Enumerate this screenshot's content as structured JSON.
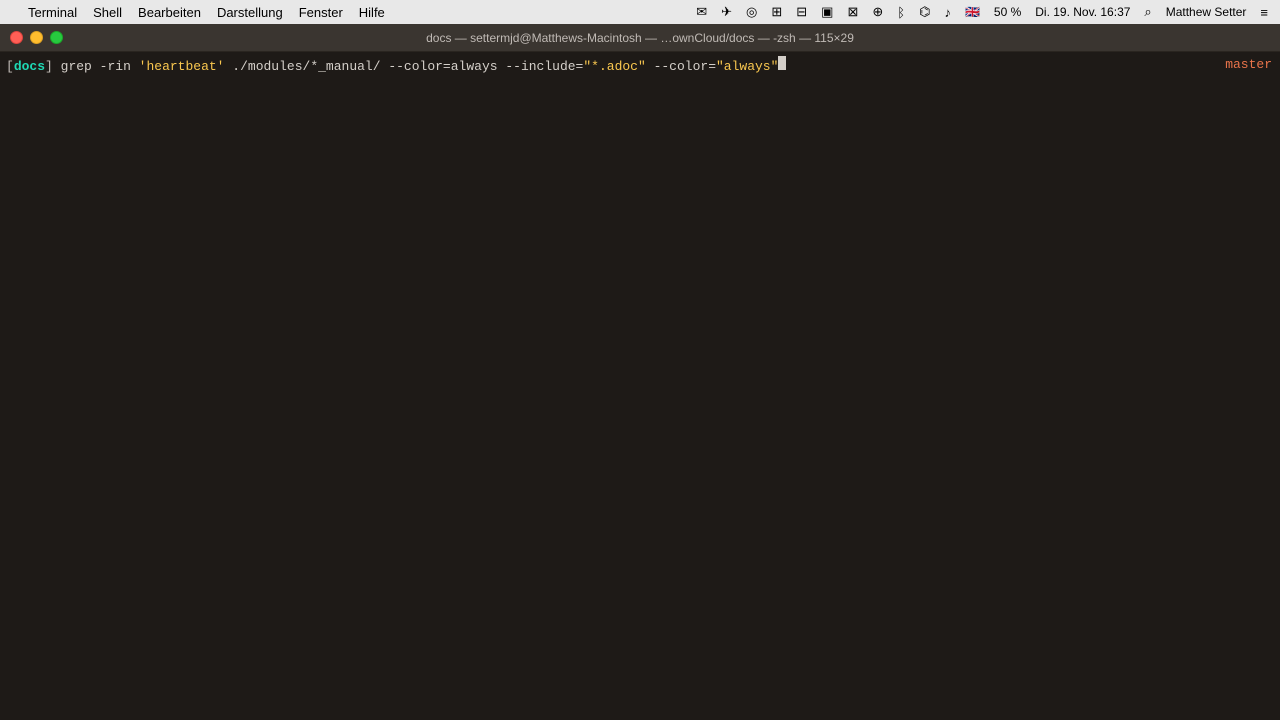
{
  "menubar": {
    "apple_label": "",
    "items": [
      {
        "id": "terminal",
        "label": "Terminal",
        "active": false
      },
      {
        "id": "shell",
        "label": "Shell",
        "active": false
      },
      {
        "id": "bearbeiten",
        "label": "Bearbeiten",
        "active": false
      },
      {
        "id": "darstellung",
        "label": "Darstellung",
        "active": false
      },
      {
        "id": "fenster",
        "label": "Fenster",
        "active": false
      },
      {
        "id": "hilfe",
        "label": "Hilfe",
        "active": false
      }
    ],
    "right": {
      "battery": "50 %",
      "datetime": "Di. 19. Nov. 16:37",
      "user": "Matthew Setter"
    }
  },
  "titlebar": {
    "text": "docs — settermjd@Matthews-Macintosh — …ownCloud/docs — -zsh — 115×29"
  },
  "terminal": {
    "prompt_dir": "docs",
    "command": "grep -rin 'heartbeat' ./modules/*_manual/ --color=always --include=\"*.adoc\" --color=\"always\"",
    "git_branch": "master",
    "prompt_bracket_open": "[",
    "prompt_bracket_close": "]",
    "prompt_space": " "
  }
}
